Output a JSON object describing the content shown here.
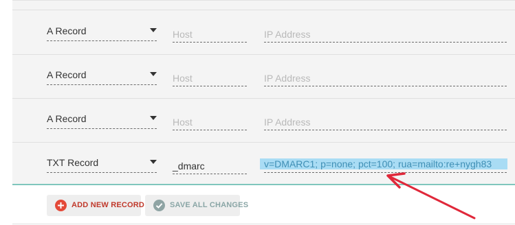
{
  "records": [
    {
      "type": "A Record",
      "host_placeholder": "Host",
      "host_value": "",
      "value_placeholder": "IP Address",
      "value": ""
    },
    {
      "type": "A Record",
      "host_placeholder": "Host",
      "host_value": "",
      "value_placeholder": "IP Address",
      "value": ""
    },
    {
      "type": "A Record",
      "host_placeholder": "Host",
      "host_value": "",
      "value_placeholder": "IP Address",
      "value": ""
    },
    {
      "type": "TXT Record",
      "host_placeholder": "",
      "host_value": "_dmarc",
      "value_placeholder": "",
      "value": "v=DMARC1; p=none; pct=100; rua=mailto:re+nygh83"
    }
  ],
  "actions": {
    "add_label": "ADD NEW RECORD",
    "save_label": "SAVE ALL CHANGES"
  },
  "colors": {
    "add_accent": "#e44938",
    "save_accent": "#8fa4a4",
    "selection_highlight": "#a9dcf4",
    "annotation_arrow": "#e0283a",
    "row_divider_accent": "#7fc6bd"
  },
  "icons": {
    "add": "plus-circle-icon",
    "save": "check-circle-icon",
    "dropdown": "caret-down-icon"
  }
}
